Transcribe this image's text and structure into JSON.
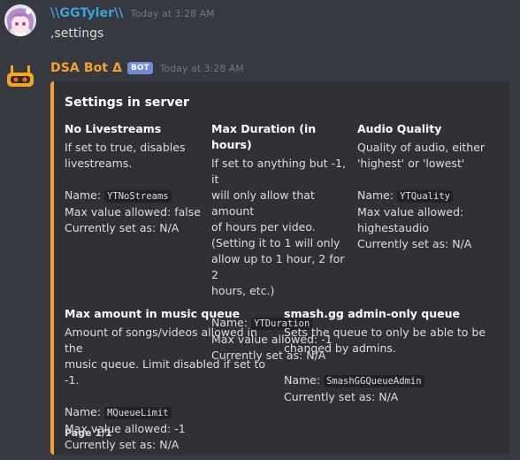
{
  "user_message": {
    "username": "\\\\GGTyler\\\\",
    "username_color": "#3ba4d9",
    "timestamp": "Today at 3:28 AM",
    "content": ",settings"
  },
  "bot_message": {
    "username": "DSA Bot Δ",
    "username_color": "#f8a02c",
    "bot_tag": "BOT",
    "timestamp": "Today at 3:28 AM",
    "avatar_icon": "bot-face-icon",
    "embed": {
      "accent_color": "#f8a02c",
      "title": "Settings in server",
      "footer": "Page 1/1",
      "fields": [
        {
          "name": "No Livestreams",
          "description": "If set to true, disables\nlivestreams.",
          "key_label": "Name:",
          "key_value": "YTNoStreams",
          "max_value": "Max value allowed: false",
          "current": "Currently set as: N/A"
        },
        {
          "name": "Max Duration (in hours)",
          "description": "If set to anything but -1, it\nwill only allow that amount\nof hours per video.\n(Setting it to 1 will only\nallow up to 1 hour, 2 for 2\nhours, etc.)",
          "key_label": "Name:",
          "key_value": "YTDuration",
          "max_value": "Max value allowed: -1",
          "current": "Currently set as: N/A"
        },
        {
          "name": "Audio Quality",
          "description": "Quality of audio, either\n'highest' or 'lowest'",
          "key_label": "Name:",
          "key_value": "YTQuality",
          "max_value": "Max value allowed:\nhighestaudio",
          "current": "Currently set as: N/A"
        },
        {
          "name": "Max amount in music queue",
          "description": "Amount of songs/videos allowed in the\nmusic queue. Limit disabled if set to -1.",
          "key_label": "Name:",
          "key_value": "MQueueLimit",
          "max_value": "Max value allowed: -1",
          "current": "Currently set as: N/A"
        },
        {
          "name": "smash.gg admin-only queue",
          "description": "Sets the queue to only be able to be\nchanged by admins.",
          "key_label": "Name:",
          "key_value": "SmashGGQueueAdmin",
          "current": "Currently set as: N/A"
        }
      ]
    }
  }
}
